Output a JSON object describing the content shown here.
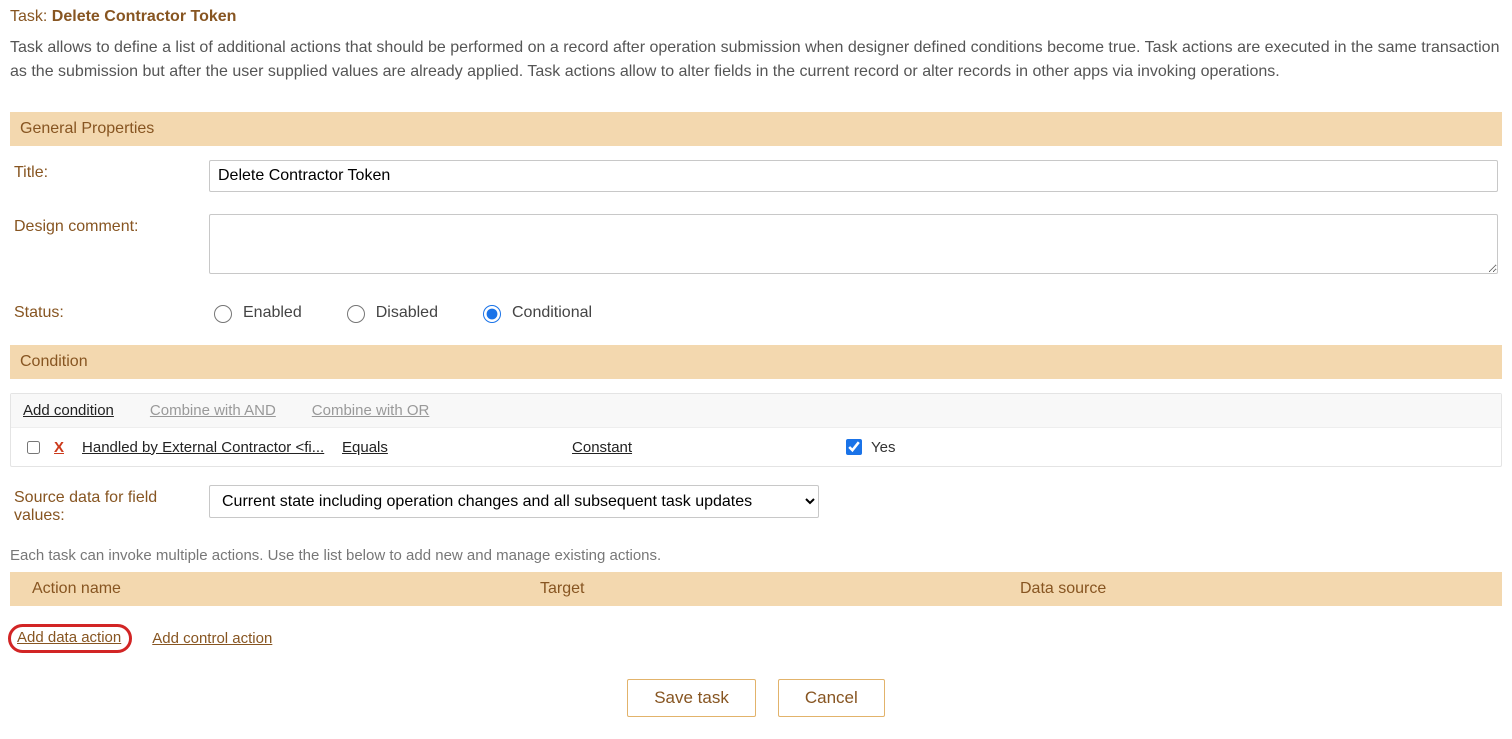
{
  "header": {
    "prefix": "Task: ",
    "title": "Delete Contractor Token"
  },
  "description": "Task allows to define a list of additional actions that should be performed on a record after operation submission when designer defined conditions become true. Task actions are executed in the same transaction as the submission but after the user supplied values are already applied. Task actions allow to alter fields in the current record or alter records in other apps via invoking operations.",
  "sections": {
    "general": "General Properties",
    "condition": "Condition"
  },
  "labels": {
    "title": "Title:",
    "design_comment": "Design comment:",
    "status": "Status:",
    "source_data": "Source data for field values:"
  },
  "fields": {
    "title_value": "Delete Contractor Token",
    "comment_value": "",
    "status": {
      "enabled": "Enabled",
      "disabled": "Disabled",
      "conditional": "Conditional",
      "selected": "conditional"
    },
    "source_data_selected": "Current state including operation changes and all subsequent task updates"
  },
  "condition_toolbar": {
    "add": "Add condition",
    "and": "Combine with AND",
    "or": "Combine with OR"
  },
  "condition_row": {
    "delete_label": "X",
    "field": "Handled by External Contractor <fi...",
    "operator": "Equals",
    "value_type": "Constant",
    "value_checked": true,
    "value_label": "Yes"
  },
  "hint": "Each task can invoke multiple actions. Use the list below to add new and manage existing actions.",
  "actions_table": {
    "col1": "Action name",
    "col2": "Target",
    "col3": "Data source"
  },
  "add_actions": {
    "data": "Add data action",
    "control": "Add control action"
  },
  "buttons": {
    "save": "Save task",
    "cancel": "Cancel"
  }
}
